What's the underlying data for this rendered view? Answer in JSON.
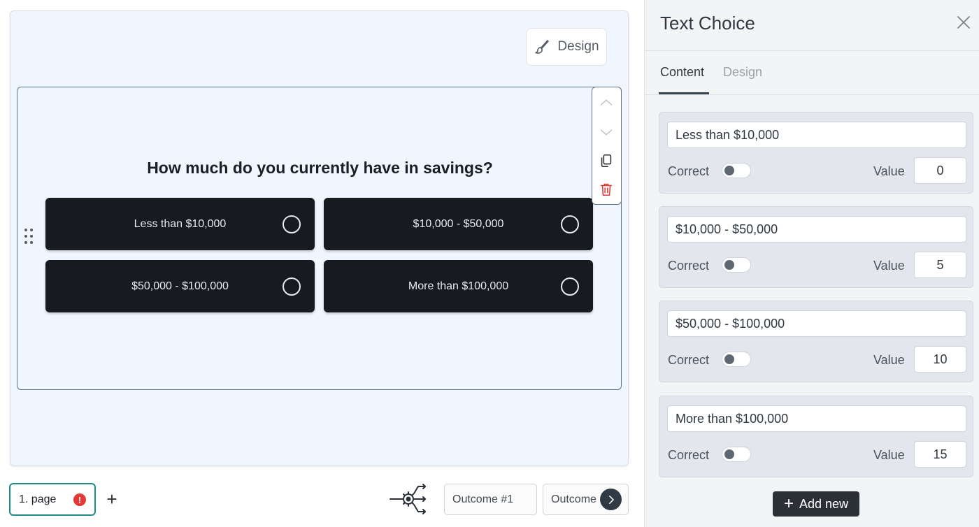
{
  "canvas": {
    "design_button": "Design",
    "question": {
      "title": "How much do you currently have in savings?",
      "answers": [
        {
          "label": "Less than $10,000"
        },
        {
          "label": "$10,000 - $50,000"
        },
        {
          "label": "$50,000 - $100,000"
        },
        {
          "label": "More than $100,000"
        }
      ]
    }
  },
  "bottom_bar": {
    "page_tab": "1. page",
    "error_badge": "!",
    "add_page": "+",
    "outcomes": [
      "Outcome #1",
      "Outcome"
    ]
  },
  "panel": {
    "title": "Text Choice",
    "tabs": {
      "content": "Content",
      "design": "Design"
    },
    "active_tab": "Content",
    "choices": [
      {
        "text": "Less than $10,000",
        "correct_label": "Correct",
        "value_label": "Value",
        "value": "0"
      },
      {
        "text": "$10,000 - $50,000",
        "correct_label": "Correct",
        "value_label": "Value",
        "value": "5"
      },
      {
        "text": "$50,000 - $100,000",
        "correct_label": "Correct",
        "value_label": "Value",
        "value": "10"
      },
      {
        "text": "More than $100,000",
        "correct_label": "Correct",
        "value_label": "Value",
        "value": "15"
      }
    ],
    "add_new": "Add new"
  },
  "colors": {
    "canvas_bg": "#eff6ff",
    "answer_bg": "#171b1f",
    "accent_teal": "#1e8c84",
    "error_red": "#e53935",
    "delete_red": "#e53935"
  },
  "icons": [
    "paintbrush-icon",
    "drag-handle-icon",
    "chevron-up-icon",
    "chevron-down-icon",
    "copy-icon",
    "trash-icon",
    "logic-gear-icon",
    "chevron-right-icon",
    "close-icon",
    "plus-icon"
  ]
}
